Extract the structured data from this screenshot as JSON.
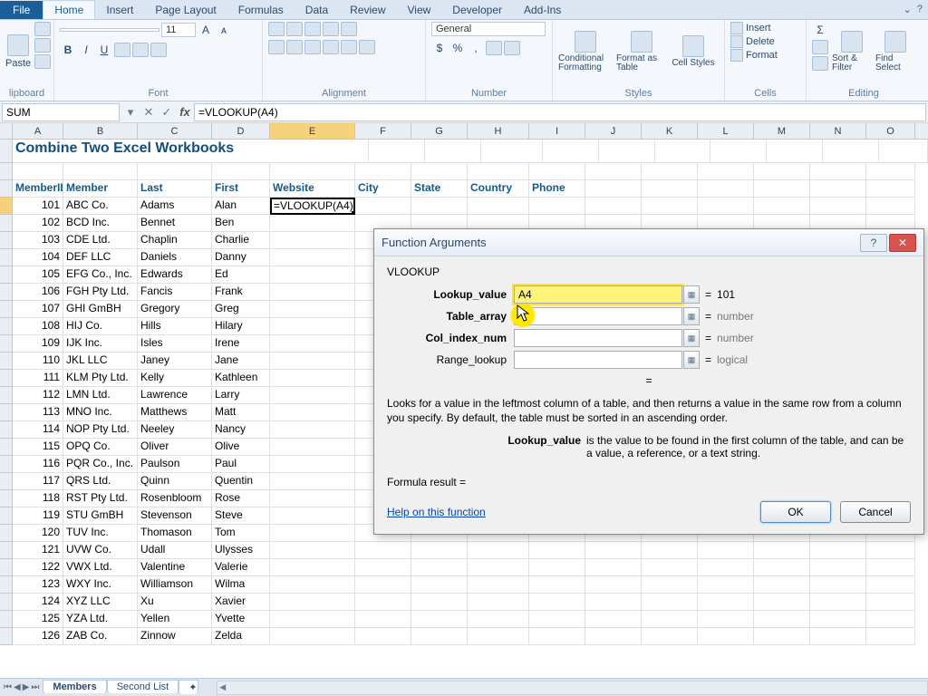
{
  "tabs": {
    "file": "File",
    "home": "Home",
    "insert": "Insert",
    "pagelayout": "Page Layout",
    "formulas": "Formulas",
    "data": "Data",
    "review": "Review",
    "view": "View",
    "developer": "Developer",
    "addins": "Add-Ins"
  },
  "ribbon": {
    "clipboard": {
      "paste": "Paste",
      "label": "lipboard"
    },
    "font": {
      "size": "11",
      "label": "Font"
    },
    "alignment": {
      "label": "Alignment"
    },
    "number": {
      "format": "General",
      "label": "Number"
    },
    "styles": {
      "cond": "Conditional Formatting",
      "table": "Format as Table",
      "cell": "Cell Styles",
      "label": "Styles"
    },
    "cells": {
      "insert": "Insert",
      "delete": "Delete",
      "format": "Format",
      "label": "Cells"
    },
    "editing": {
      "sort": "Sort & Filter",
      "find": "Find Select",
      "label": "Editing"
    }
  },
  "formulabar": {
    "name": "SUM",
    "formula": "=VLOOKUP(A4)"
  },
  "columns": [
    "A",
    "B",
    "C",
    "D",
    "E",
    "F",
    "G",
    "H",
    "I",
    "J",
    "K",
    "L",
    "M",
    "N",
    "O"
  ],
  "title": "Combine Two Excel Workbooks",
  "headers": {
    "a": "MemberID",
    "b": "Member",
    "c": "Last",
    "d": "First",
    "e": "Website",
    "f": "City",
    "g": "State",
    "h": "Country",
    "i": "Phone"
  },
  "cellE4": "=VLOOKUP(A4)",
  "rows": [
    {
      "id": "101",
      "m": "ABC Co.",
      "l": "Adams",
      "f": "Alan"
    },
    {
      "id": "102",
      "m": "BCD Inc.",
      "l": "Bennet",
      "f": "Ben"
    },
    {
      "id": "103",
      "m": "CDE Ltd.",
      "l": "Chaplin",
      "f": "Charlie"
    },
    {
      "id": "104",
      "m": "DEF LLC",
      "l": "Daniels",
      "f": "Danny"
    },
    {
      "id": "105",
      "m": "EFG Co., Inc.",
      "l": "Edwards",
      "f": "Ed"
    },
    {
      "id": "106",
      "m": "FGH Pty Ltd.",
      "l": "Fancis",
      "f": "Frank"
    },
    {
      "id": "107",
      "m": "GHI GmBH",
      "l": "Gregory",
      "f": "Greg"
    },
    {
      "id": "108",
      "m": "HIJ Co.",
      "l": "Hills",
      "f": "Hilary"
    },
    {
      "id": "109",
      "m": "IJK Inc.",
      "l": "Isles",
      "f": "Irene"
    },
    {
      "id": "110",
      "m": "JKL LLC",
      "l": "Janey",
      "f": "Jane"
    },
    {
      "id": "111",
      "m": "KLM Pty Ltd.",
      "l": "Kelly",
      "f": "Kathleen"
    },
    {
      "id": "112",
      "m": "LMN Ltd.",
      "l": "Lawrence",
      "f": "Larry"
    },
    {
      "id": "113",
      "m": "MNO Inc.",
      "l": "Matthews",
      "f": "Matt"
    },
    {
      "id": "114",
      "m": "NOP Pty Ltd.",
      "l": "Neeley",
      "f": "Nancy"
    },
    {
      "id": "115",
      "m": "OPQ Co.",
      "l": "Oliver",
      "f": "Olive"
    },
    {
      "id": "116",
      "m": "PQR Co., Inc.",
      "l": "Paulson",
      "f": "Paul"
    },
    {
      "id": "117",
      "m": "QRS Ltd.",
      "l": "Quinn",
      "f": "Quentin"
    },
    {
      "id": "118",
      "m": "RST Pty Ltd.",
      "l": "Rosenbloom",
      "f": "Rose"
    },
    {
      "id": "119",
      "m": "STU GmBH",
      "l": "Stevenson",
      "f": "Steve"
    },
    {
      "id": "120",
      "m": "TUV Inc.",
      "l": "Thomason",
      "f": "Tom"
    },
    {
      "id": "121",
      "m": "UVW Co.",
      "l": "Udall",
      "f": "Ulysses"
    },
    {
      "id": "122",
      "m": "VWX Ltd.",
      "l": "Valentine",
      "f": "Valerie"
    },
    {
      "id": "123",
      "m": "WXY Inc.",
      "l": "Williamson",
      "f": "Wilma"
    },
    {
      "id": "124",
      "m": "XYZ LLC",
      "l": "Xu",
      "f": "Xavier"
    },
    {
      "id": "125",
      "m": "YZA Ltd.",
      "l": "Yellen",
      "f": "Yvette"
    },
    {
      "id": "126",
      "m": "ZAB Co.",
      "l": "Zinnow",
      "f": "Zelda"
    }
  ],
  "sheets": {
    "s1": "Members",
    "s2": "Second List"
  },
  "dialog": {
    "title": "Function Arguments",
    "fn": "VLOOKUP",
    "args": {
      "lookup_value": {
        "label": "Lookup_value",
        "value": "A4",
        "result": "101"
      },
      "table_array": {
        "label": "Table_array",
        "value": "",
        "result": "number"
      },
      "col_index": {
        "label": "Col_index_num",
        "value": "",
        "result": "number"
      },
      "range_lookup": {
        "label": "Range_lookup",
        "value": "",
        "result": "logical"
      }
    },
    "eq_only": "=",
    "desc": "Looks for a value in the leftmost column of a table, and then returns a value in the same row from a column you specify. By default, the table must be sorted in an ascending order.",
    "desc2label": "Lookup_value",
    "desc2": "is the value to be found in the first column of the table, and can be a value, a reference, or a text string.",
    "formula_result": "Formula result =",
    "help": "Help on this function",
    "ok": "OK",
    "cancel": "Cancel"
  }
}
